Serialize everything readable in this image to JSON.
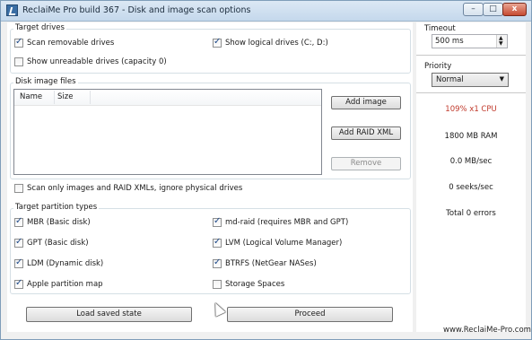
{
  "window": {
    "title": "ReclaiMe Pro build 367 - Disk and image scan options",
    "controls": {
      "minimize": "–",
      "maximize": "□",
      "close": "x"
    }
  },
  "target_drives": {
    "label": "Target drives",
    "options": [
      {
        "label": "Scan removable drives",
        "checked": true
      },
      {
        "label": "Show logical drives (C:, D:)",
        "checked": true
      },
      {
        "label": "Show unreadable drives (capacity 0)",
        "checked": false
      }
    ]
  },
  "disk_image_files": {
    "label": "Disk image files",
    "columns": [
      "Name",
      "Size"
    ],
    "buttons": {
      "add_image": "Add image",
      "add_raid_xml": "Add RAID XML",
      "remove": "Remove"
    }
  },
  "scan_only_images": {
    "label": "Scan only images and RAID XMLs, ignore physical drives",
    "checked": false
  },
  "partition_types": {
    "label": "Target partition types",
    "options": [
      {
        "label": "MBR (Basic disk)",
        "checked": true
      },
      {
        "label": "md-raid (requires MBR and GPT)",
        "checked": true
      },
      {
        "label": "GPT (Basic disk)",
        "checked": true
      },
      {
        "label": "LVM (Logical Volume Manager)",
        "checked": true
      },
      {
        "label": "LDM (Dynamic disk)",
        "checked": true
      },
      {
        "label": "BTRFS (NetGear NASes)",
        "checked": true
      },
      {
        "label": "Apple partition map",
        "checked": true
      },
      {
        "label": "Storage Spaces",
        "checked": false
      }
    ]
  },
  "bottom_buttons": {
    "load_saved_state": "Load saved state",
    "proceed": "Proceed"
  },
  "timeout": {
    "label": "Timeout",
    "value": "500 ms"
  },
  "priority": {
    "label": "Priority",
    "value": "Normal"
  },
  "stats": {
    "cpu": "109% x1 CPU",
    "ram": "1800 MB RAM",
    "speed": "0.0 MB/sec",
    "seeks": "0 seeks/sec",
    "errors": "Total 0 errors"
  },
  "colors": {
    "cpu_text": "#c0392b"
  },
  "watermark": "www.ReclaiMe-Pro.com"
}
